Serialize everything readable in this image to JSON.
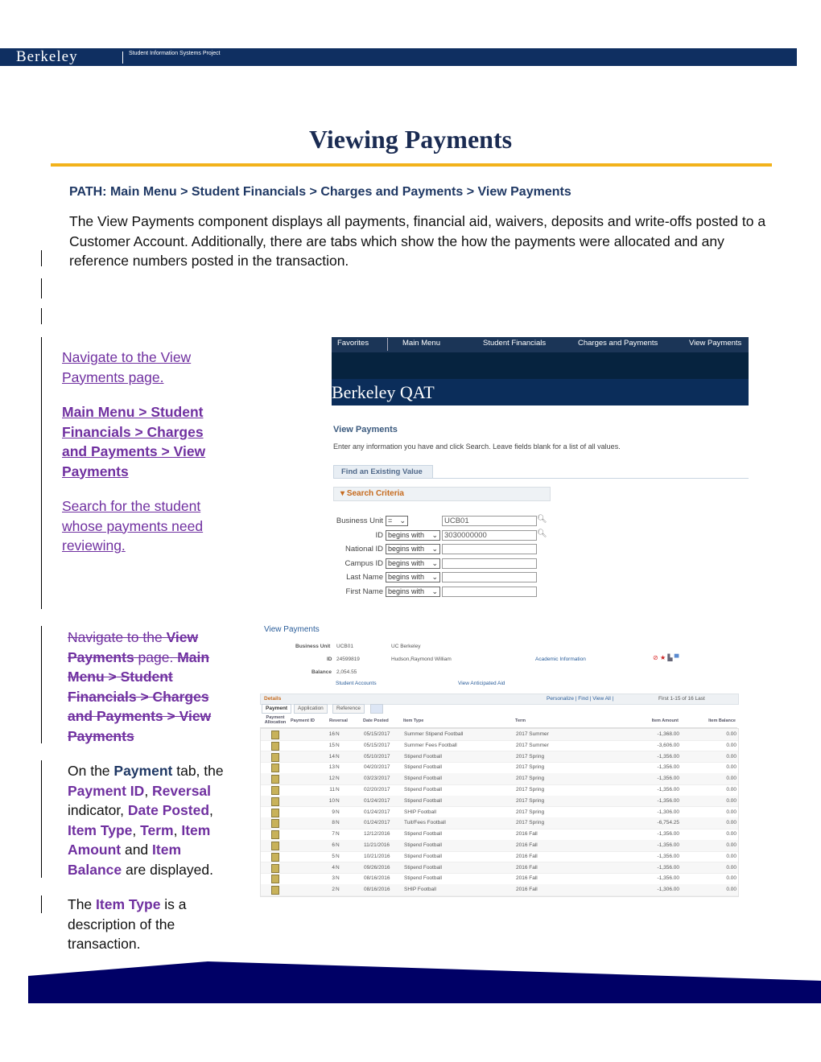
{
  "header": {
    "logo": "Berkeley",
    "subtitle": "Student Information Systems Project"
  },
  "title": "Viewing Payments",
  "path": "PATH: Main Menu > Student Financials > Charges and Payments > View Payments",
  "intro": "The View Payments component displays all payments, financial aid, waivers, deposits and write-offs posted to a Customer Account.  Additionally, there are tabs which show the how the payments were allocated and any reference numbers posted in the transaction.",
  "steps1": {
    "nav": "Navigate to the View Payments page.",
    "path": " Main Menu > Student Financials > Charges and Payments > View Payments",
    "search": "Search for the student whose payments need reviewing."
  },
  "steps2": {
    "nav_a": "Navigate to the ",
    "nav_b": "View Payments",
    "nav_c": " page. ",
    "path": "Main Menu > Student Financials > Charges and Payments > View Payments",
    "desc": {
      "t1": "On the ",
      "payment": "Payment",
      "t2": " tab, the ",
      "pid": "Payment ID",
      "c1": ", ",
      "rev": "Reversal",
      "t3": " indicator, ",
      "date": "Date Posted",
      "c2": ", ",
      "itype": "Item Type",
      "c3": ", ",
      "term": "Term",
      "c4": ", ",
      "iamt": "Item Amount",
      "t4": " and ",
      "ibal": "Item Balance",
      "t5": " are displayed."
    },
    "note": {
      "t1": "The ",
      "itype": "Item Type",
      "t2": " is a description of the transaction."
    }
  },
  "shot1": {
    "nav": [
      "Favorites",
      "Main Menu",
      "Student Financials",
      "Charges and Payments",
      "View Payments"
    ],
    "brand": "Berkeley QAT",
    "title": "View Payments",
    "instructions": "Enter any information you have and click Search. Leave fields blank for a list of all values.",
    "tab": "Find an Existing Value",
    "criteria": "Search Criteria",
    "fields": [
      {
        "label": "Business Unit",
        "op": "=",
        "value": "UCB01"
      },
      {
        "label": "ID",
        "op": "begins with",
        "value": "3030000000"
      },
      {
        "label": "National ID",
        "op": "begins with",
        "value": ""
      },
      {
        "label": "Campus ID",
        "op": "begins with",
        "value": ""
      },
      {
        "label": "Last Name",
        "op": "begins with",
        "value": ""
      },
      {
        "label": "First Name",
        "op": "begins with",
        "value": ""
      }
    ]
  },
  "shot2": {
    "title": "View Payments",
    "bu_label": "Business Unit",
    "bu": "UCB01",
    "bu_name": "UC Berkeley",
    "id_label": "ID",
    "id": "24599819",
    "name": "Hudson,Raymond William",
    "acad": "Academic Information",
    "bal_label": "Balance",
    "balance": "2,054.55",
    "student_accounts": "Student Accounts",
    "anticipated": "View Anticipated Aid",
    "details": "Details",
    "toolbar": "Personalize | Find | View All |",
    "pager": "First  1-15 of 16  Last",
    "tabs": [
      "Payment",
      "Application",
      "Reference"
    ],
    "columns": [
      "Payment Allocation",
      "Payment ID",
      "Reversal",
      "Date Posted",
      "Item Type",
      "Term",
      "Item Amount",
      "Item Balance"
    ],
    "rows": [
      [
        "16",
        "N",
        "05/15/2017",
        "Summer Stipend Football",
        "2017 Summer",
        "-1,368.00",
        "0.00"
      ],
      [
        "15",
        "N",
        "05/15/2017",
        "Summer Fees Football",
        "2017 Summer",
        "-3,606.00",
        "0.00"
      ],
      [
        "14",
        "N",
        "05/10/2017",
        "Stipend Football",
        "2017 Spring",
        "-1,356.00",
        "0.00"
      ],
      [
        "13",
        "N",
        "04/20/2017",
        "Stipend Football",
        "2017 Spring",
        "-1,356.00",
        "0.00"
      ],
      [
        "12",
        "N",
        "03/23/2017",
        "Stipend Football",
        "2017 Spring",
        "-1,356.00",
        "0.00"
      ],
      [
        "11",
        "N",
        "02/20/2017",
        "Stipend Football",
        "2017 Spring",
        "-1,356.00",
        "0.00"
      ],
      [
        "10",
        "N",
        "01/24/2017",
        "Stipend Football",
        "2017 Spring",
        "-1,356.00",
        "0.00"
      ],
      [
        "9",
        "N",
        "01/24/2017",
        "SHIP Football",
        "2017 Spring",
        "-1,306.00",
        "0.00"
      ],
      [
        "8",
        "N",
        "01/24/2017",
        "Tuit/Fees Football",
        "2017 Spring",
        "-6,754.25",
        "0.00"
      ],
      [
        "7",
        "N",
        "12/12/2016",
        "Stipend Football",
        "2016 Fall",
        "-1,356.00",
        "0.00"
      ],
      [
        "6",
        "N",
        "11/21/2016",
        "Stipend Football",
        "2016 Fall",
        "-1,356.00",
        "0.00"
      ],
      [
        "5",
        "N",
        "10/21/2016",
        "Stipend Football",
        "2016 Fall",
        "-1,356.00",
        "0.00"
      ],
      [
        "4",
        "N",
        "09/26/2016",
        "Stipend Football",
        "2016 Fall",
        "-1,356.00",
        "0.00"
      ],
      [
        "3",
        "N",
        "08/16/2016",
        "Stipend Football",
        "2016 Fall",
        "-1,356.00",
        "0.00"
      ],
      [
        "2",
        "N",
        "08/16/2016",
        "SHIP Football",
        "2016 Fall",
        "-1,306.00",
        "0.00"
      ]
    ]
  },
  "colors": {
    "navy": "#0f2f61",
    "gold": "#f2b21b",
    "purple": "#7030a0",
    "footer": "#000066"
  }
}
